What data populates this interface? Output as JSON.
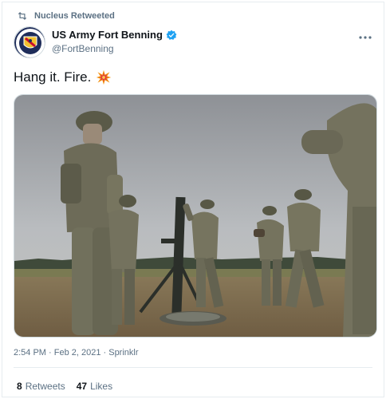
{
  "retweet_context": {
    "text": "Nucleus Retweeted",
    "icon": "retweet-icon"
  },
  "author": {
    "display_name": "US Army Fort Benning",
    "handle": "@FortBenning",
    "verified": true
  },
  "tweet": {
    "text": "Hang it. Fire.",
    "emoji": "collision-emoji"
  },
  "media": {
    "kind": "photo",
    "subject": "soldiers-firing-mortar"
  },
  "meta": {
    "time": "2:54 PM",
    "date": "Feb 2, 2021",
    "source": "Sprinklr",
    "line": "2:54 PM · Feb 2, 2021 · Sprinklr"
  },
  "stats": {
    "retweets_count": "8",
    "retweets_label": "Retweets",
    "likes_count": "47",
    "likes_label": "Likes"
  },
  "colors": {
    "text_primary": "#0f1419",
    "text_secondary": "#5b7083",
    "verified_blue": "#1da1f2",
    "divider": "#e6ecf0"
  }
}
